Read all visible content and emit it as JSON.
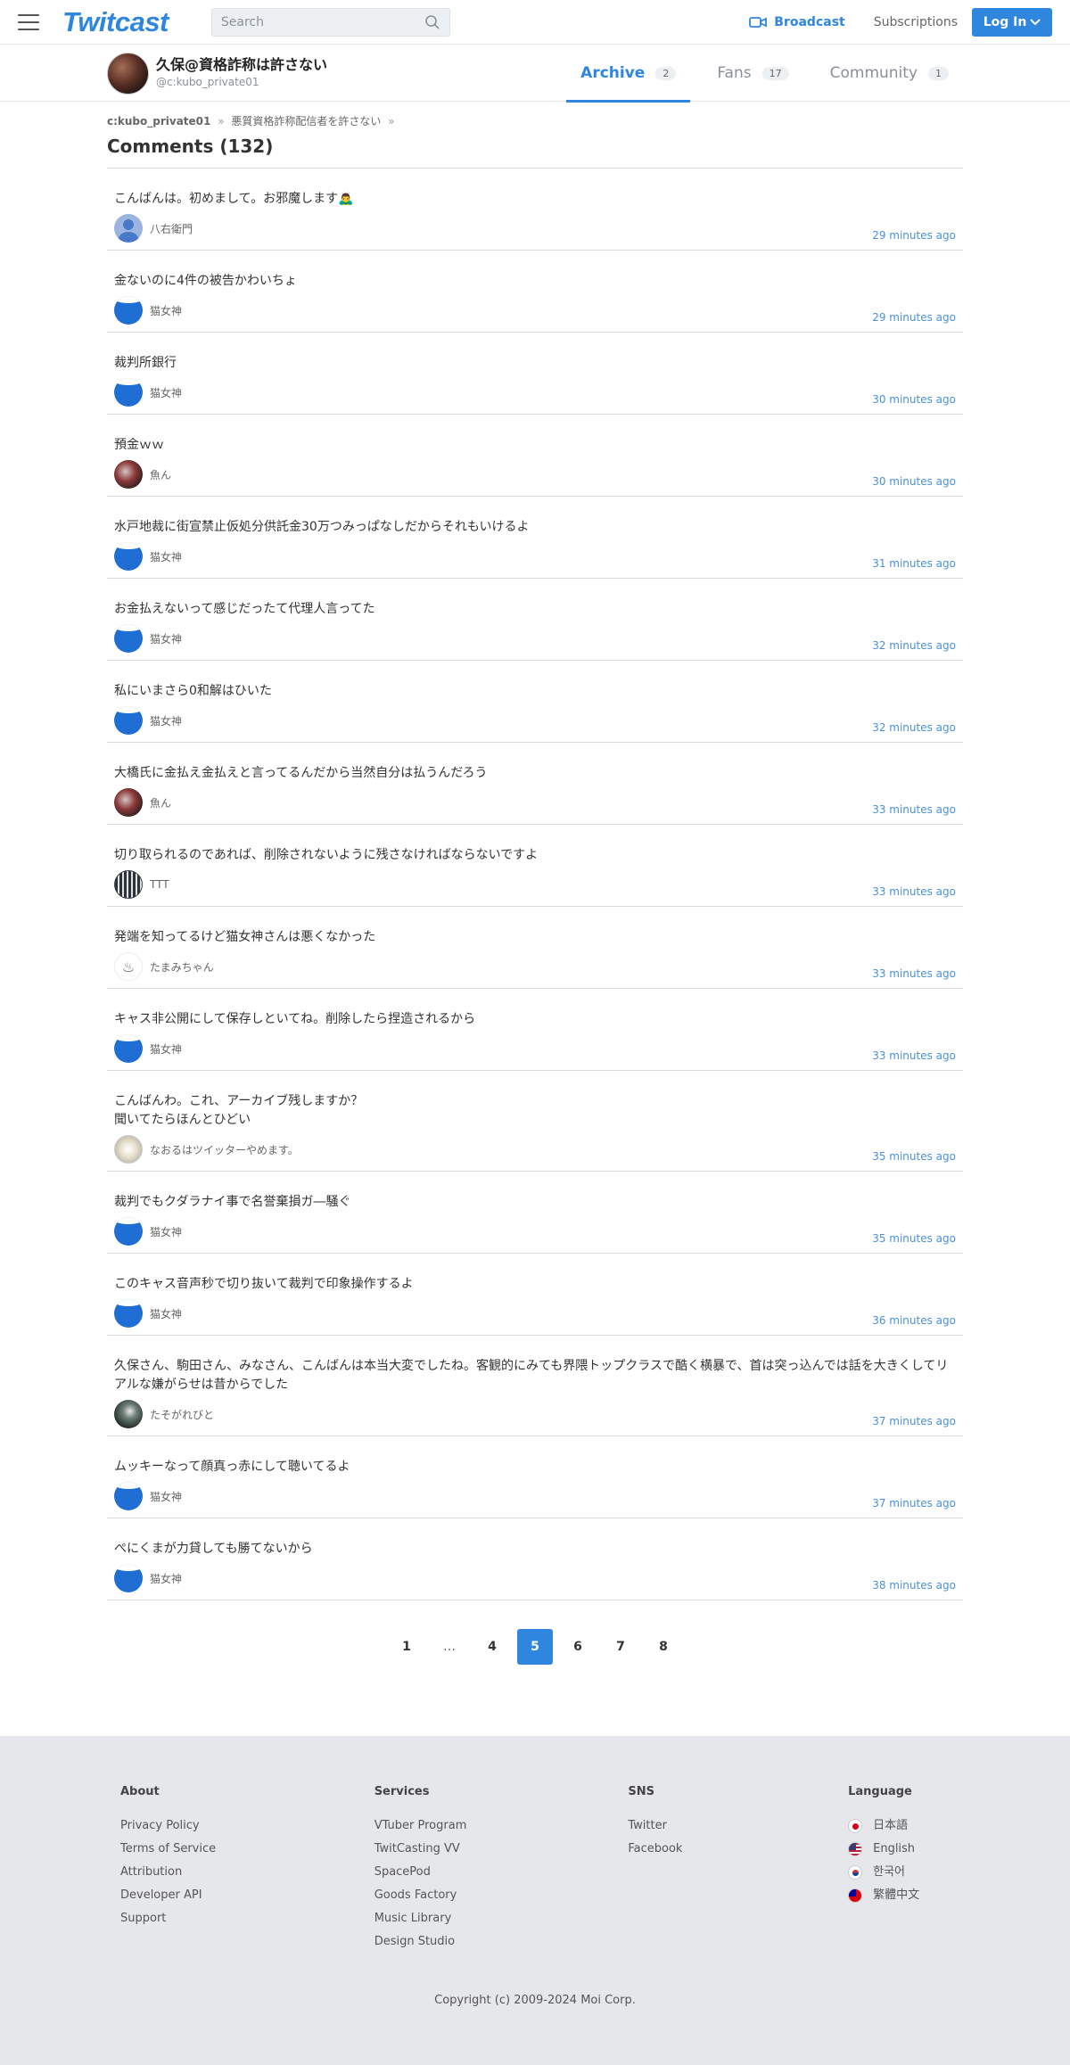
{
  "header": {
    "logo": "Twitcast",
    "search_placeholder": "Search",
    "broadcast_label": "Broadcast",
    "subscriptions_label": "Subscriptions",
    "login_label": "Log In"
  },
  "profile": {
    "name": "久保@資格詐称は許さない",
    "handle": "@c:kubo_private01",
    "tabs": [
      {
        "label": "Archive",
        "count": "2",
        "active": true
      },
      {
        "label": "Fans",
        "count": "17",
        "active": false
      },
      {
        "label": "Community",
        "count": "1",
        "active": false
      }
    ]
  },
  "breadcrumb": {
    "first": "c:kubo_private01",
    "second": "悪質資格詐称配信者を許さない",
    "sep1": "»",
    "sep2": "»"
  },
  "page_title": "Comments (132)",
  "comments": [
    {
      "text": "こんばんは。初めまして。お邪魔します🙇‍♂️",
      "user": "八右衛門",
      "time": "29 minutes ago",
      "avatar": "default"
    },
    {
      "text": "金ないのに4件の被告かわいちょ",
      "user": "猫女神",
      "time": "29 minutes ago",
      "avatar": "neko"
    },
    {
      "text": "裁判所銀行",
      "user": "猫女神",
      "time": "30 minutes ago",
      "avatar": "neko"
    },
    {
      "text": "預金ｗｗ",
      "user": "魚ん",
      "time": "30 minutes ago",
      "avatar": "uo"
    },
    {
      "text": "水戸地裁に街宣禁止仮処分供託金30万つみっぱなしだからそれもいけるよ",
      "user": "猫女神",
      "time": "31 minutes ago",
      "avatar": "neko"
    },
    {
      "text": "お金払えないって感じだったて代理人言ってた",
      "user": "猫女神",
      "time": "32 minutes ago",
      "avatar": "neko"
    },
    {
      "text": "私にいまさら0和解はひいた",
      "user": "猫女神",
      "time": "32 minutes ago",
      "avatar": "neko"
    },
    {
      "text": "大橋氏に金払え金払えと言ってるんだから当然自分は払うんだろう",
      "user": "魚ん",
      "time": "33 minutes ago",
      "avatar": "uo"
    },
    {
      "text": "切り取られるのであれば、削除されないように残さなければならないですよ",
      "user": "TTT",
      "time": "33 minutes ago",
      "avatar": "ttt"
    },
    {
      "text": "発端を知ってるけど猫女神さんは悪くなかった",
      "user": "たまみちゃん",
      "time": "33 minutes ago",
      "avatar": "tama"
    },
    {
      "text": "キャス非公開にして保存しといてね。削除したら捏造されるから",
      "user": "猫女神",
      "time": "33 minutes ago",
      "avatar": "neko"
    },
    {
      "text": "こんばんわ。これ、アーカイブ残しますか？\n聞いてたらほんとひどい",
      "user": "なおるはツイッターやめます。",
      "time": "35 minutes ago",
      "avatar": "nao",
      "multi": true
    },
    {
      "text": "裁判でもクダラナイ事で名誉棄損ガ―騒ぐ",
      "user": "猫女神",
      "time": "35 minutes ago",
      "avatar": "neko"
    },
    {
      "text": "このキャス音声秒で切り抜いて裁判で印象操作するよ",
      "user": "猫女神",
      "time": "36 minutes ago",
      "avatar": "neko"
    },
    {
      "text": "久保さん、駒田さん、みなさん、こんばんは󠄀本当大変でしたね。客観的にみても界隈トップクラスで酷く横暴で、首は突っ込んでは話を大きくしてリアルな嫌がらせは昔からでした󠄀",
      "user": "たそがれびと",
      "time": "37 minutes ago",
      "avatar": "taso",
      "multi": true
    },
    {
      "text": "ムッキーなって顔真っ赤にして聴いてるよ",
      "user": "猫女神",
      "time": "37 minutes ago",
      "avatar": "neko"
    },
    {
      "text": "ぺにくまが力貸しても勝てないから",
      "user": "猫女神",
      "time": "38 minutes ago",
      "avatar": "neko"
    }
  ],
  "pagination": {
    "pages": [
      "1",
      "…",
      "4",
      "5",
      "6",
      "7",
      "8"
    ],
    "current": "5"
  },
  "footer": {
    "about": {
      "title": "About",
      "links": [
        "Privacy Policy",
        "Terms of Service",
        "Attribution",
        "Developer API",
        "Support"
      ]
    },
    "services": {
      "title": "Services",
      "links": [
        "VTuber Program",
        "TwitCasting VV",
        "SpacePod",
        "Goods Factory",
        "Music Library",
        "Design Studio"
      ]
    },
    "sns": {
      "title": "SNS",
      "links": [
        "Twitter",
        "Facebook"
      ]
    },
    "language": {
      "title": "Language",
      "links": [
        "日本語",
        "English",
        "한국어",
        "繁體中文"
      ]
    },
    "copyright": "Copyright (c) 2009-2024 Moi Corp."
  },
  "colors": {
    "accent": "#2e86de",
    "time": "#4a90d9",
    "footer_bg": "#e5e7ea"
  },
  "icons": [
    "hamburger-icon",
    "search-icon",
    "video-camera-icon",
    "chevron-down-icon"
  ]
}
